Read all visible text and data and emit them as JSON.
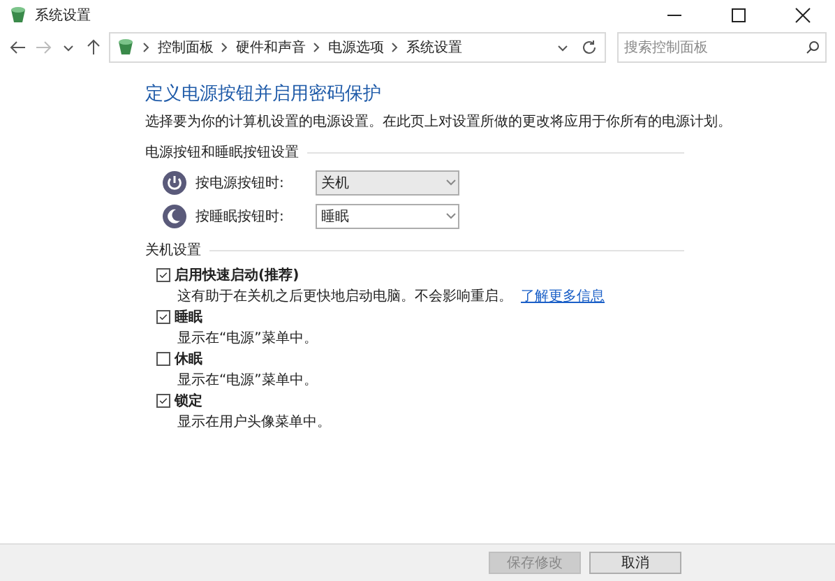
{
  "window": {
    "title": "系统设置"
  },
  "address_bar": {
    "breadcrumbs": [
      "控制面板",
      "硬件和声音",
      "电源选项",
      "系统设置"
    ],
    "search": {
      "placeholder": "搜索控制面板"
    }
  },
  "heading": "定义电源按钮并启用密码保护",
  "description": "选择要为你的计算机设置的电源设置。在此页上对设置所做的更改将应用于你所有的电源计划。",
  "power_section": {
    "title": "电源按钮和睡眠按钮设置",
    "rows": [
      {
        "kind": "power",
        "label": "按电源按钮时:",
        "value": "关机",
        "focused": true
      },
      {
        "kind": "sleep",
        "label": "按睡眠按钮时:",
        "value": "睡眠",
        "focused": false
      }
    ]
  },
  "shutdown_section": {
    "title": "关机设置",
    "options": [
      {
        "label": "启用快速启动(推荐)",
        "checked": true,
        "description": "这有助于在关机之后更快地启动电脑。不会影响重启。",
        "link": "了解更多信息"
      },
      {
        "label": "睡眠",
        "checked": true,
        "description": "显示在“电源”菜单中。"
      },
      {
        "label": "休眠",
        "checked": false,
        "description": "显示在“电源”菜单中。"
      },
      {
        "label": "锁定",
        "checked": true,
        "description": "显示在用户头像菜单中。"
      }
    ]
  },
  "buttons": [
    {
      "label": "保存修改",
      "disabled": true
    },
    {
      "label": "取消",
      "disabled": false
    }
  ]
}
